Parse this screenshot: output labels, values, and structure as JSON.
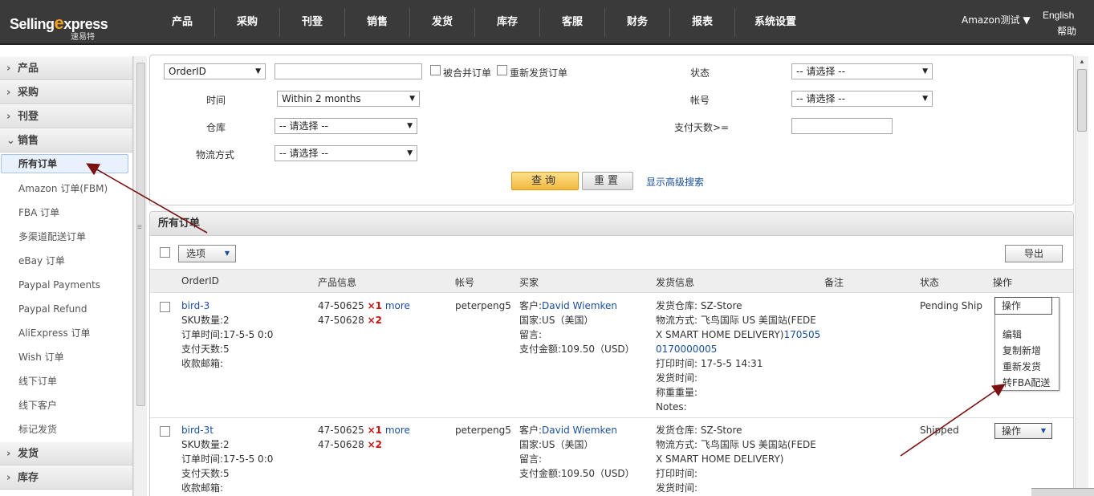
{
  "logo": {
    "brand_a": "Selling",
    "brand_x": "e",
    "brand_b": "xpress",
    "sub": "速易特"
  },
  "nav": [
    "产品",
    "采购",
    "刊登",
    "销售",
    "发货",
    "库存",
    "客服",
    "财务",
    "报表",
    "系统设置"
  ],
  "account": {
    "name": "Amazon测试 ▼",
    "lang": "English",
    "help": "帮助"
  },
  "sidebar": {
    "groups_top": [
      {
        "label": "产品",
        "chevron": "›"
      },
      {
        "label": "采购",
        "chevron": "›"
      },
      {
        "label": "刊登",
        "chevron": "›"
      },
      {
        "label": "销售",
        "chevron": "⌄"
      }
    ],
    "sales_items": [
      "所有订单",
      "Amazon 订单(FBM)",
      "FBA 订单",
      "多渠道配送订单",
      "eBay 订单",
      "Paypal Payments",
      "Paypal Refund",
      "AliExpress 订单",
      "Wish 订单",
      "线下订单",
      "线下客户",
      "标记发货"
    ],
    "groups_bottom": [
      {
        "label": "发货",
        "chevron": "›"
      },
      {
        "label": "库存",
        "chevron": "›"
      }
    ],
    "grip": "≡"
  },
  "search": {
    "field_select": "OrderID",
    "merged_label": "被合并订单",
    "resend_label": "重新发货订单",
    "status_label": "状态",
    "status_value": "-- 请选择 --",
    "time_label": "时间",
    "time_value": "Within 2 months",
    "account_label": "帐号",
    "account_value": "-- 请选择 --",
    "warehouse_label": "仓库",
    "warehouse_value": "-- 请选择 --",
    "paydays_label": "支付天数>=",
    "shipping_label": "物流方式",
    "shipping_value": "-- 请选择 --",
    "query_btn": "查询",
    "reset_btn": "重置",
    "advanced_link": "显示高级搜索"
  },
  "orders": {
    "title": "所有订单",
    "options_btn": "选项",
    "export_btn": "导出",
    "columns": [
      "OrderID",
      "产品信息",
      "帐号",
      "买家",
      "发货信息",
      "备注",
      "状态",
      "操作"
    ],
    "rows": [
      {
        "id": "bird-3",
        "sku": "SKU数量:2",
        "order_time": "订单时间:17-5-5 0:0",
        "pay_days": "支付天数:5",
        "email": "收款邮箱:",
        "prod1": "47-50625",
        "qty1": "×1",
        "more": "more",
        "prod2": "47-50628",
        "qty2": "×2",
        "account": "peterpeng5",
        "buyer_label": "客户:",
        "buyer": "David Wiemken",
        "country": "国家:US（美国）",
        "message": "留言:",
        "amount": "支付金额:109.50（USD）",
        "ship_wh": "发货仓库: SZ-Store",
        "ship_method_1": "物流方式: 飞鸟国际 US 美国站(FEDE",
        "ship_method_2": "X SMART HOME DELIVERY)",
        "tracking_1": "170505",
        "tracking_2": "0170000005",
        "print_time": "打印时间: 17-5-5 14:31",
        "ship_time": "发货时间:",
        "weight": "称重重量:",
        "notes": "Notes:",
        "status": "Pending Ship",
        "ops": "操作",
        "menu": [
          "编辑",
          "复制新增",
          "重新发货",
          "转FBA配送"
        ]
      },
      {
        "id": "bird-3t",
        "sku": "SKU数量:2",
        "order_time": "订单时间:17-5-5 0:0",
        "pay_days": "支付天数:5",
        "email": "收款邮箱:",
        "prod1": "47-50625",
        "qty1": "×1",
        "more": "more",
        "prod2": "47-50628",
        "qty2": "×2",
        "account": "peterpeng5",
        "buyer_label": "客户:",
        "buyer": "David Wiemken",
        "country": "国家:US（美国）",
        "message": "留言:",
        "amount": "支付金额:109.50（USD）",
        "ship_wh": "发货仓库: SZ-Store",
        "ship_method_1": "物流方式: 飞鸟国际 US 美国站(FEDE",
        "ship_method_2": "X SMART HOME DELIVERY)",
        "print_time": "打印时间:",
        "ship_time": "发货时间:",
        "status": "Shipped",
        "ops": "操作"
      }
    ]
  },
  "colors": {
    "topbar": "#3a3a3a",
    "link": "#1a4f99",
    "qty": "#cc1111",
    "arrow": "#7a1010",
    "query_btn": "#f2b83c"
  }
}
